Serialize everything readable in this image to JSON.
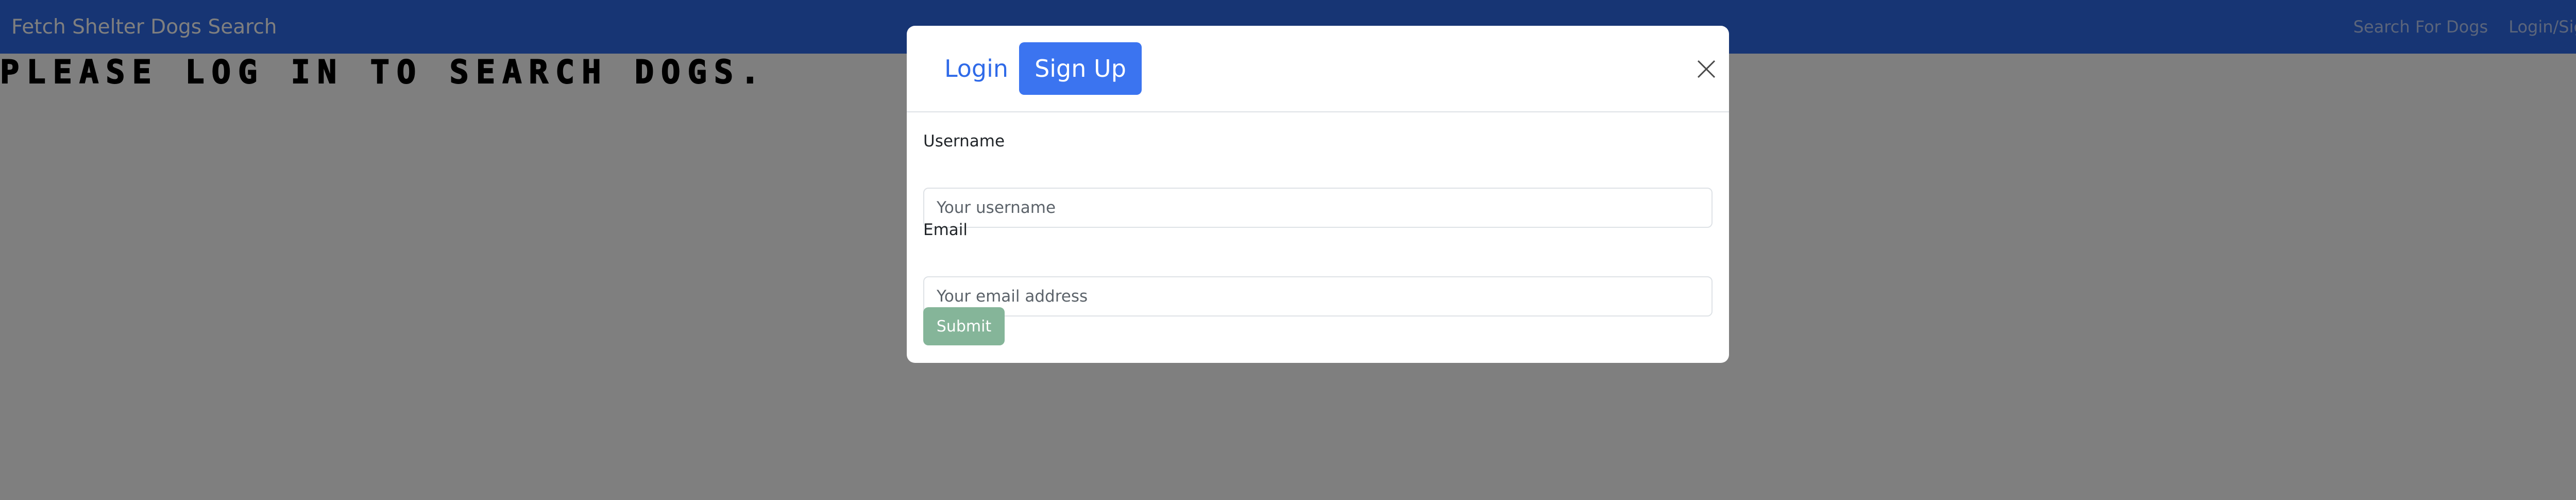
{
  "navbar": {
    "brand": "Fetch Shelter Dogs Search",
    "links": [
      "Search For Dogs",
      "Login/Sign Up"
    ]
  },
  "main": {
    "heading": "PLEASE LOG IN TO SEARCH DOGS."
  },
  "modal": {
    "tabs": [
      {
        "label": "Login",
        "active": false
      },
      {
        "label": "Sign Up",
        "active": true
      }
    ],
    "close_icon": "close-icon",
    "fields": [
      {
        "label": "Username",
        "placeholder": "Your username",
        "value": ""
      },
      {
        "label": "Email",
        "placeholder": "Your email address",
        "value": ""
      }
    ],
    "submit_label": "Submit"
  },
  "colors": {
    "navbar_bg": "#2f6ae8",
    "primary": "#3b74f0",
    "submit_bg": "#85b599",
    "overlay": "rgba(0,0,0,0.5)"
  }
}
